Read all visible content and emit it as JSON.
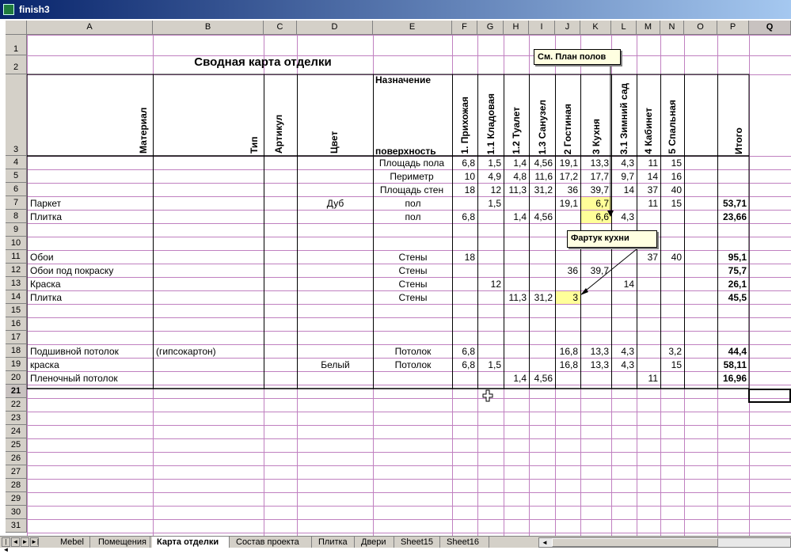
{
  "window": {
    "title": "finish3"
  },
  "columns": [
    "A",
    "B",
    "C",
    "D",
    "E",
    "F",
    "G",
    "H",
    "I",
    "J",
    "K",
    "L",
    "M",
    "N",
    "O",
    "P",
    "Q"
  ],
  "selected_column": "Q",
  "rows": [
    "1",
    "2",
    "3",
    "4",
    "5",
    "6",
    "7",
    "8",
    "9",
    "10",
    "11",
    "12",
    "13",
    "14",
    "15",
    "16",
    "17",
    "18",
    "19",
    "20",
    "21",
    "22",
    "23",
    "24",
    "25",
    "26",
    "27",
    "28",
    "29",
    "30",
    "31"
  ],
  "selected_row": "21",
  "sheet_title": "Сводная карта отделки",
  "headers": {
    "material": "Материал",
    "type": "Тип",
    "article": "Артикул",
    "color": "Цвет",
    "purpose_top": "Назначение",
    "purpose_bottom": "поверхность",
    "rooms": [
      "1. Прихожая",
      "1.1 Кладовая",
      "1.2 Туалет",
      "1.3 Санузел",
      "2 Гостиная",
      "3 Кухня",
      "3.1 Зимний сад",
      "4 Кабинет",
      "5 Спальная"
    ],
    "total": "Итого"
  },
  "cells": {
    "E4": "Площадь пола",
    "F4": "6,8",
    "G4": "1,5",
    "H4": "1,4",
    "I4": "4,56",
    "J4": "19,1",
    "K4": "13,3",
    "L4": "4,3",
    "M4": "11",
    "N4": "15",
    "E5": "Периметр",
    "F5": "10",
    "G5": "4,9",
    "H5": "4,8",
    "I5": "11,6",
    "J5": "17,2",
    "K5": "17,7",
    "L5": "9,7",
    "M5": "14",
    "N5": "16",
    "E6": "Площадь стен",
    "F6": "18",
    "G6": "12",
    "H6": "11,3",
    "I6": "31,2",
    "J6": "36",
    "K6": "39,7",
    "L6": "14",
    "M6": "37",
    "N6": "40",
    "A7": "Паркет",
    "D7": "Дуб",
    "E7": "пол",
    "G7": "1,5",
    "J7": "19,1",
    "K7": "6,7",
    "M7": "11",
    "N7": "15",
    "P7": "53,71",
    "A8": "Плитка",
    "E8": "пол",
    "F8": "6,8",
    "H8": "1,4",
    "I8": "4,56",
    "K8": "6,6",
    "L8": "4,3",
    "P8": "23,66",
    "A11": "Обои",
    "E11": "Стены",
    "F11": "18",
    "M11": "37",
    "N11": "40",
    "P11": "95,1",
    "A12": "Обои под покраску",
    "E12": "Стены",
    "J12": "36",
    "K12": "39,7",
    "P12": "75,7",
    "A13": "Краска",
    "E13": "Стены",
    "G13": "12",
    "L13": "14",
    "P13": "26,1",
    "A14": "Плитка",
    "E14": "Стены",
    "H14": "11,3",
    "I14": "31,2",
    "J14": "3",
    "P14": "45,5",
    "A18": "Подшивной потолок",
    "B18": "(гипсокартон)",
    "E18": "Потолок",
    "F18": "6,8",
    "J18": "16,8",
    "K18": "13,3",
    "L18": "4,3",
    "N18": "3,2",
    "P18": "44,4",
    "A19": "краска",
    "D19": "Белый",
    "E19": "Потолок",
    "F19": "6,8",
    "G19": "1,5",
    "J19": "16,8",
    "K19": "13,3",
    "L19": "4,3",
    "N19": "15",
    "P19": "58,11",
    "A20": "Пленочный потолок",
    "H20": "1,4",
    "I20": "4,56",
    "M20": "11",
    "P20": "16,96"
  },
  "comments": {
    "plan": "См. План полов",
    "apron": "Фартук кухни"
  },
  "tabs": [
    "Mebel",
    "Помещения",
    "Карта отделки",
    "Состав проекта",
    "Плитка",
    "Двери",
    "Sheet15",
    "Sheet16"
  ],
  "active_tab": "Карта отделки",
  "colors": {
    "header_bg": "#d4d0c8",
    "highlight": "#ffff99",
    "comment_bg": "#ffffe1",
    "grid": "#c080c0"
  }
}
